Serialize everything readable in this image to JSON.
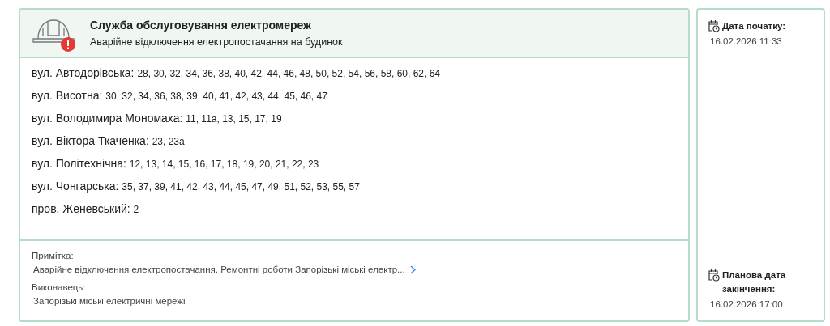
{
  "header": {
    "title": "Служба обслуговування електромереж",
    "subtitle": "Аварійне відключення електропостачання на будинок",
    "alert": true
  },
  "addresses": [
    {
      "street": "вул. Автодорівська:",
      "houses": "28, 30, 32, 34, 36, 38, 40, 42, 44, 46, 48, 50, 52, 54, 56, 58, 60, 62, 64"
    },
    {
      "street": "вул. Висотна:",
      "houses": "30, 32, 34, 36, 38, 39, 40, 41, 42, 43, 44, 45, 46, 47"
    },
    {
      "street": "вул. Володимира Мономаха:",
      "houses": "11, 11а, 13, 15, 17, 19"
    },
    {
      "street": "вул. Віктора Ткаченка:",
      "houses": "23, 23а"
    },
    {
      "street": "вул. Політехнічна:",
      "houses": "12, 13, 14, 15, 16, 17, 18, 19, 20, 21, 22, 23"
    },
    {
      "street": "вул. Чонгарська:",
      "houses": "35, 37, 39, 41, 42, 43, 44, 45, 47, 49, 51, 52, 53, 55, 57"
    },
    {
      "street": "пров. Женевський:",
      "houses": "2"
    }
  ],
  "note": {
    "label": "Примітка:",
    "text": "Аварійне відключення електропостачання. Ремонтні роботи Запорізькі міські електр..."
  },
  "executor": {
    "label": "Виконавець:",
    "text": "Запорізькі міські електричні мережі"
  },
  "start": {
    "label": "Дата початку:",
    "value": "16.02.2026 11:33"
  },
  "end": {
    "label": "Планова дата закінчення:",
    "value": "16.02.2026 17:00"
  }
}
